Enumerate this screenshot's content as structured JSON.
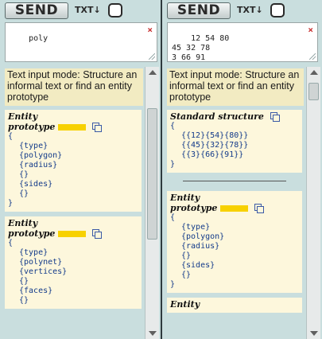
{
  "left_panel": {
    "send_label": "SEND",
    "txt_label": "TXT↓",
    "input_value": "poly",
    "clear_icon": "×",
    "hint_text": "Text input mode: Structure an informal text or find an entity prototype",
    "cards": [
      {
        "title_line1": "Entity",
        "title_line2": "prototype",
        "open": "{",
        "lines": [
          "{type}",
          "{polygon}",
          "{radius}",
          "{}",
          "{sides}",
          "{}"
        ],
        "close": "}"
      },
      {
        "title_line1": "Entity",
        "title_line2": "prototype",
        "open": "{",
        "lines": [
          "{type}",
          "{polynet}",
          "{vertices}",
          "{}",
          "{faces}",
          "{}"
        ],
        "close": ""
      }
    ]
  },
  "right_panel": {
    "send_label": "SEND",
    "txt_label": "TXT↓",
    "input_value": "12 54 80\n45 32 78\n3 66 91",
    "clear_icon": "×",
    "hint_text": "Text input mode: Structure an informal text or find an entity prototype",
    "structure_card": {
      "title": "Standard structure",
      "open": "{",
      "lines": [
        "{{12}{54}{80}}",
        "{{45}{32}{78}}",
        "{{3}{66}{91}}"
      ],
      "close": "}"
    },
    "entity_card": {
      "title_line1": "Entity",
      "title_line2": "prototype",
      "open": "{",
      "lines": [
        "{type}",
        "{polygon}",
        "{radius}",
        "{}",
        "{sides}",
        "{}"
      ],
      "close": "}"
    },
    "partial_card_title": "Entity"
  },
  "colors": {
    "panel_bg": "#c9dede",
    "hint_bg": "#f2ebc2",
    "card_bg": "#fdf7dc",
    "code_text": "#123a8a",
    "highlight_bar": "#f7d100",
    "clear_red": "#c62b2b"
  },
  "icons": {
    "clear": "close-icon",
    "copy": "copy-icon",
    "resize": "resize-grip-icon"
  }
}
